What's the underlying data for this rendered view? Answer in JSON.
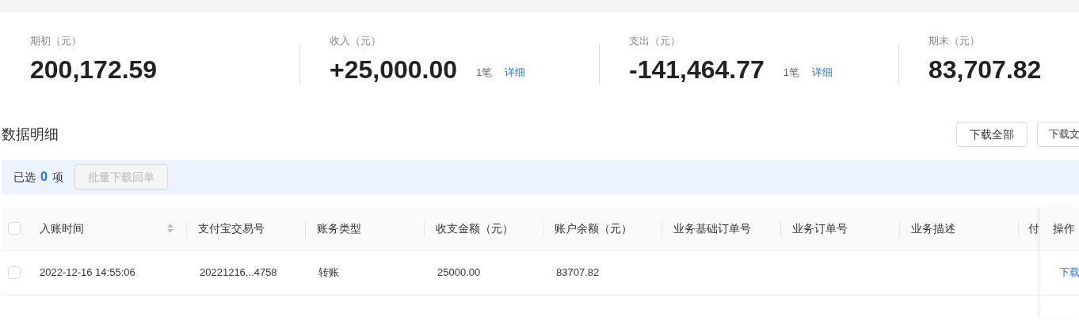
{
  "summary": [
    {
      "label": "期初（元）",
      "value": "200,172.59"
    },
    {
      "label": "收入（元）",
      "value": "+25,000.00",
      "count": "1笔",
      "link": "详细"
    },
    {
      "label": "支出（元）",
      "value": "-141,464.77",
      "count": "1笔",
      "link": "详细"
    },
    {
      "label": "期末（元）",
      "value": "83,707.82"
    }
  ],
  "section_title": "数据明细",
  "toolbar_buttons": [
    "下载全部",
    "下载文"
  ],
  "selection": {
    "prefix": "已选",
    "count": "0",
    "suffix": "项",
    "batch_button": {
      "label": "批量下载回单",
      "disabled": true
    }
  },
  "table": {
    "select_all": {
      "checked": false
    },
    "columns": [
      {
        "label": "入账时间",
        "sortable": true
      },
      {
        "label": "支付宝交易号",
        "sortable": false
      },
      {
        "label": "账务类型",
        "sortable": false
      },
      {
        "label": "收支金额（元）",
        "sortable": false
      },
      {
        "label": "账户余额（元）",
        "sortable": false
      },
      {
        "label": "业务基础订单号",
        "sortable": false
      },
      {
        "label": "业务订单号",
        "sortable": false
      },
      {
        "label": "业务描述",
        "sortable": false
      },
      {
        "label": "付",
        "sortable": false
      }
    ],
    "action_column": "操作",
    "rows": [
      {
        "checked": false,
        "cells": [
          "2022-12-16 14:55:06",
          "20221216...4758",
          "转账",
          "25000.00",
          "83707.82",
          "",
          "",
          "",
          ""
        ],
        "action": "下载"
      }
    ]
  }
}
